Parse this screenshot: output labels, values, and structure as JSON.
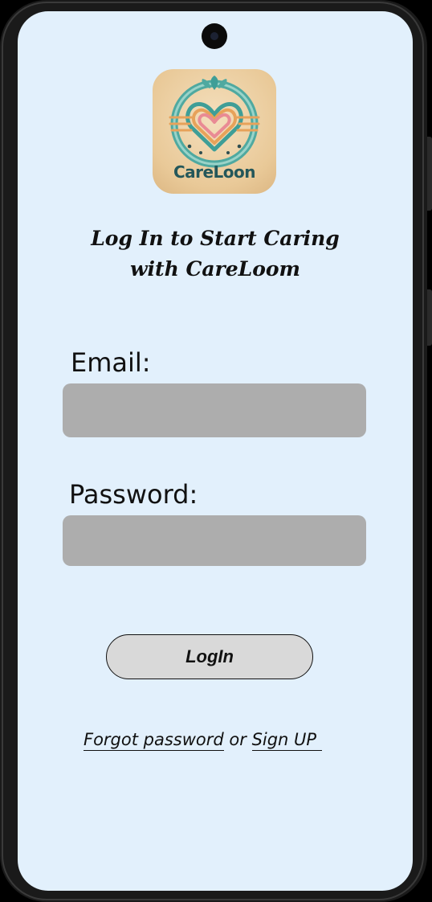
{
  "app": {
    "logo_text": "CareLoon"
  },
  "login": {
    "headline_line1": "Log In to Start Caring",
    "headline_line2": "with CareLoom",
    "email_label": "Email:",
    "email_value": "",
    "password_label": "Password:",
    "password_value": "",
    "login_button_label": "LogIn",
    "forgot_password_link": "Forgot password",
    "or_text": " or ",
    "sign_up_link": "Sign UP "
  },
  "colors": {
    "screen_background": "#e2f0fc",
    "input_background": "#adadad",
    "button_background": "#d9d9d9",
    "logo_text": "#24575a"
  },
  "icons": {
    "logo_emblem": "heart-loom-emblem-icon"
  }
}
